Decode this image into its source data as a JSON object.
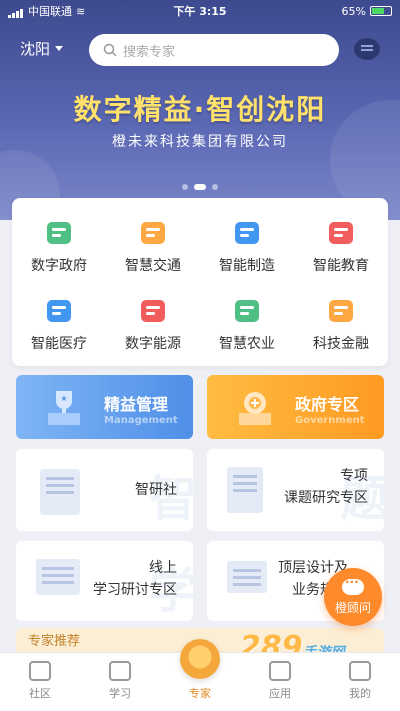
{
  "status": {
    "carrier": "中国联通",
    "time": "下午 3:15",
    "battery": "65%",
    "battery_level": 0.65
  },
  "header": {
    "city": "沈阳",
    "search_placeholder": "搜索专家"
  },
  "banner": {
    "title": "数字精益·智创沈阳",
    "subtitle": "橙未来科技集团有限公司",
    "pages": 3,
    "active_page": 1
  },
  "categories": [
    {
      "label": "数字政府",
      "icon": "government-building-icon",
      "color": "#3cb878"
    },
    {
      "label": "智慧交通",
      "icon": "car-icon",
      "color": "#ff9d2e"
    },
    {
      "label": "智能制造",
      "icon": "wrench-gear-icon",
      "color": "#2e8cf0"
    },
    {
      "label": "智能教育",
      "icon": "graduation-cap-icon",
      "color": "#ef4b4b"
    },
    {
      "label": "智能医疗",
      "icon": "medical-kit-icon",
      "color": "#2e8cf0"
    },
    {
      "label": "数字能源",
      "icon": "energy-icon",
      "color": "#ef4b4b"
    },
    {
      "label": "智慧农业",
      "icon": "plant-cloud-icon",
      "color": "#3cb878"
    },
    {
      "label": "科技金融",
      "icon": "finance-yuan-icon",
      "color": "#ff9d2e"
    }
  ],
  "features": {
    "lean": {
      "title": "精益管理",
      "subtitle": "Management"
    },
    "gov": {
      "title": "政府专区",
      "subtitle": "Government"
    },
    "research": {
      "label": "智研社",
      "watermark": "智"
    },
    "topic": {
      "line1": "专项",
      "line2": "课题研究专区",
      "watermark": "题"
    },
    "study": {
      "line1": "线上",
      "line2": "学习研讨专区",
      "watermark": "学"
    },
    "design": {
      "line1": "顶层设计及",
      "line2": "业务规划"
    }
  },
  "recommend": {
    "label": "专家推荐"
  },
  "fab": {
    "label": "橙顾问"
  },
  "watermark": {
    "text": "289",
    "suffix": "手游网"
  },
  "tabs": [
    {
      "label": "社区",
      "icon": "community-icon"
    },
    {
      "label": "学习",
      "icon": "book-icon"
    },
    {
      "label": "专家",
      "icon": "expert-medal-icon",
      "active": true
    },
    {
      "label": "应用",
      "icon": "apps-icon"
    },
    {
      "label": "我的",
      "icon": "profile-icon"
    }
  ]
}
